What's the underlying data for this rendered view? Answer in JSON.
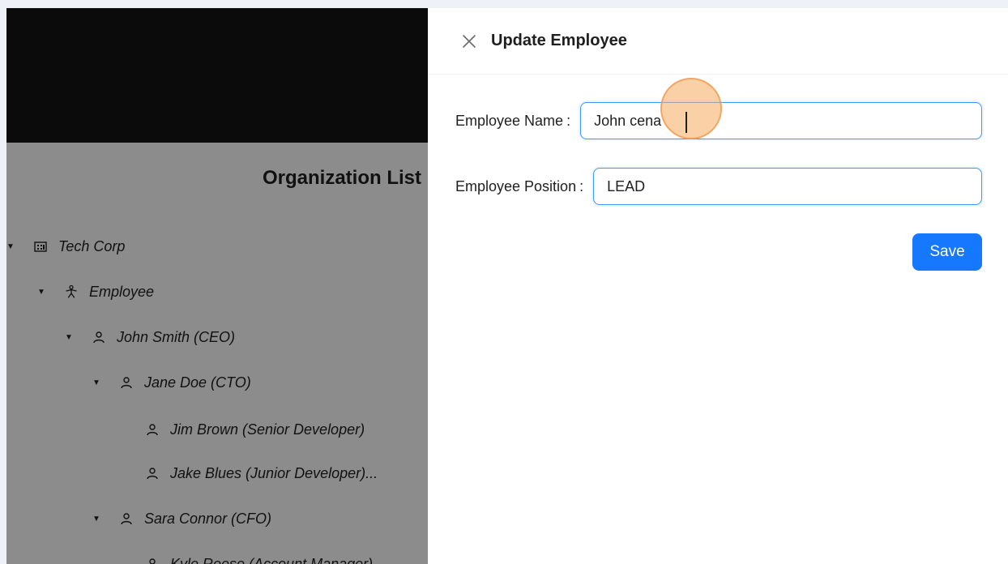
{
  "app": {
    "org_list_title": "Organization List",
    "tree": [
      {
        "label": "Tech Corp",
        "icon": "building-icon",
        "expanded": true,
        "has_children": true,
        "level": 0
      },
      {
        "label": "Employee",
        "icon": "person-group-icon",
        "expanded": true,
        "has_children": true,
        "level": 1
      },
      {
        "label": "John Smith (CEO)",
        "icon": "user-icon",
        "expanded": true,
        "has_children": true,
        "level": 2
      },
      {
        "label": "Jane Doe (CTO)",
        "icon": "user-icon",
        "expanded": true,
        "has_children": true,
        "level": 3
      },
      {
        "label": "Jim Brown (Senior Developer)",
        "icon": "user-icon",
        "has_children": false,
        "level": 4
      },
      {
        "label": "Jake Blues (Junior Developer)...",
        "icon": "user-icon",
        "has_children": false,
        "level": 4
      },
      {
        "label": "Sara Connor (CFO)",
        "icon": "user-icon",
        "expanded": true,
        "has_children": true,
        "level": 3
      },
      {
        "label": "Kyle Reese (Account Manager)",
        "icon": "user-icon",
        "has_children": false,
        "level": 4
      }
    ]
  },
  "drawer": {
    "title": "Update Employee",
    "close_icon": "close-icon",
    "fields": {
      "name": {
        "label": "Employee Name",
        "colon": ":",
        "value": "John cena"
      },
      "position": {
        "label": "Employee Position",
        "colon": ":",
        "value": "LEAD"
      }
    },
    "save_label": "Save"
  },
  "colors": {
    "primary": "#1677ff",
    "input_border": "#4096ff",
    "header_dark": "#141414",
    "mask": "rgba(0,0,0,0.45)",
    "click_indicator": "#f5aa5f"
  }
}
